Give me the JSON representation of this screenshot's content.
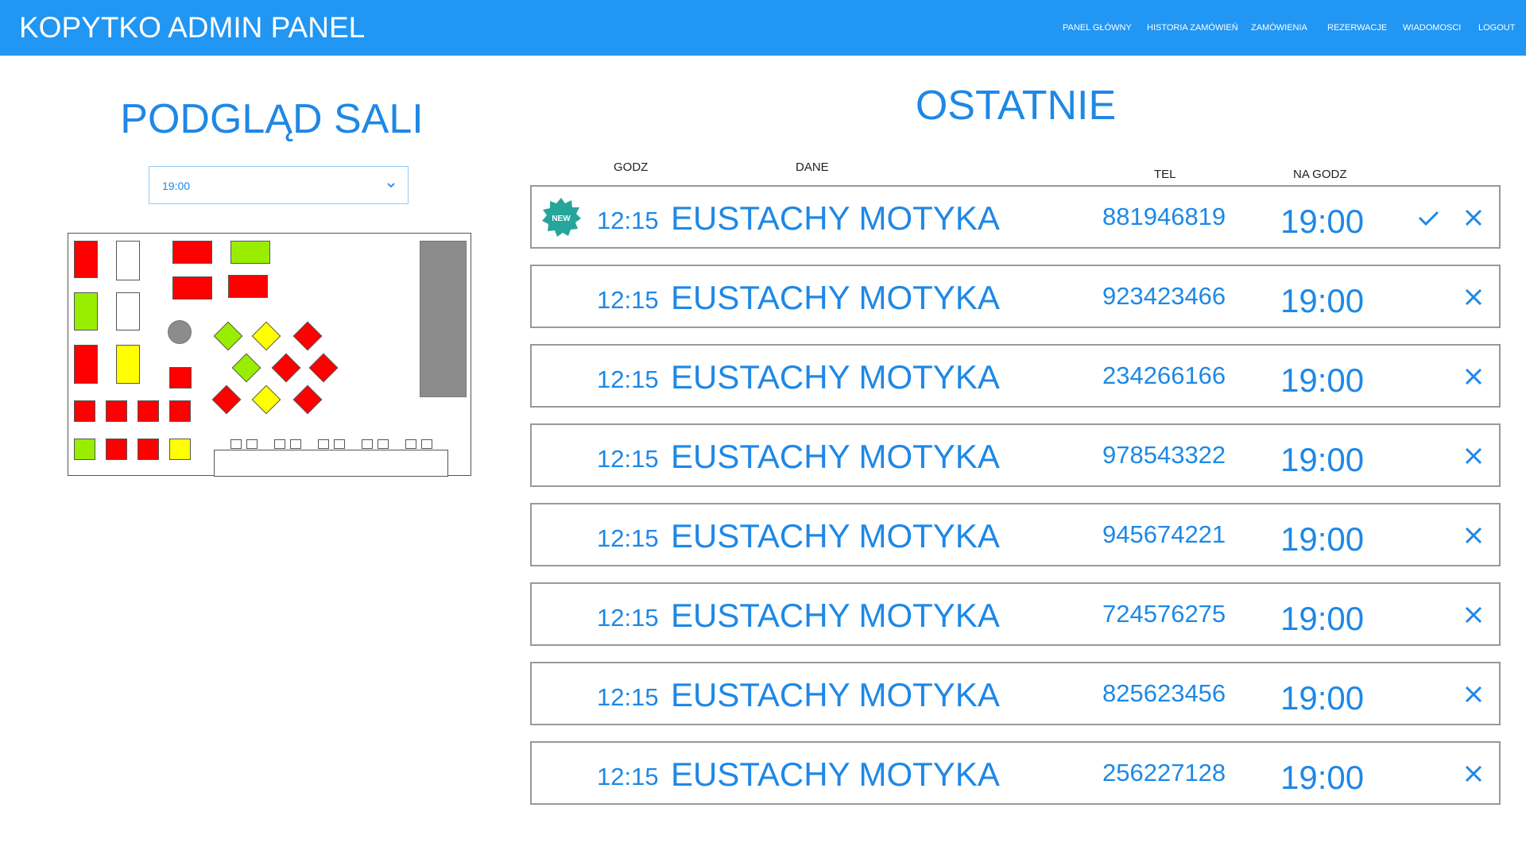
{
  "header": {
    "title": "KOPYTKO ADMIN PANEL",
    "nav": [
      "PANEL GŁÓWNY",
      "HISTORIA ZAMÓWIEŃ",
      "ZAMÓWIENIA",
      "REZERWACJE",
      "WIADOMOSCI",
      "LOGOUT"
    ]
  },
  "hall": {
    "title": "PODGLĄD SALI",
    "selected_time": "19:00",
    "dropdown_icon": "chevron-down-icon"
  },
  "recent": {
    "title": "OSTATNIE",
    "columns": {
      "time": "GODZ",
      "name": "DANE",
      "tel": "TEL",
      "at": "NA GODZ"
    },
    "badge_text": "NEW",
    "rows": [
      {
        "time": "12:15",
        "name": "EUSTACHY MOTYKA",
        "tel": "881946819",
        "at": "19:00",
        "is_new": true
      },
      {
        "time": "12:15",
        "name": "EUSTACHY MOTYKA",
        "tel": "923423466",
        "at": "19:00",
        "is_new": false
      },
      {
        "time": "12:15",
        "name": "EUSTACHY MOTYKA",
        "tel": "234266166",
        "at": "19:00",
        "is_new": false
      },
      {
        "time": "12:15",
        "name": "EUSTACHY MOTYKA",
        "tel": "978543322",
        "at": "19:00",
        "is_new": false
      },
      {
        "time": "12:15",
        "name": "EUSTACHY MOTYKA",
        "tel": "945674221",
        "at": "19:00",
        "is_new": false
      },
      {
        "time": "12:15",
        "name": "EUSTACHY MOTYKA",
        "tel": "724576275",
        "at": "19:00",
        "is_new": false
      },
      {
        "time": "12:15",
        "name": "EUSTACHY MOTYKA",
        "tel": "825623456",
        "at": "19:00",
        "is_new": false
      },
      {
        "time": "12:15",
        "name": "EUSTACHY MOTYKA",
        "tel": "256227128",
        "at": "19:00",
        "is_new": false
      }
    ]
  },
  "colors": {
    "brand": "#2196f3",
    "text_accent": "#1e88e5",
    "table_occupied": "#ff0000",
    "table_free": "#99ee00",
    "table_reserved": "#ffff00",
    "badge": "#26a69a"
  }
}
